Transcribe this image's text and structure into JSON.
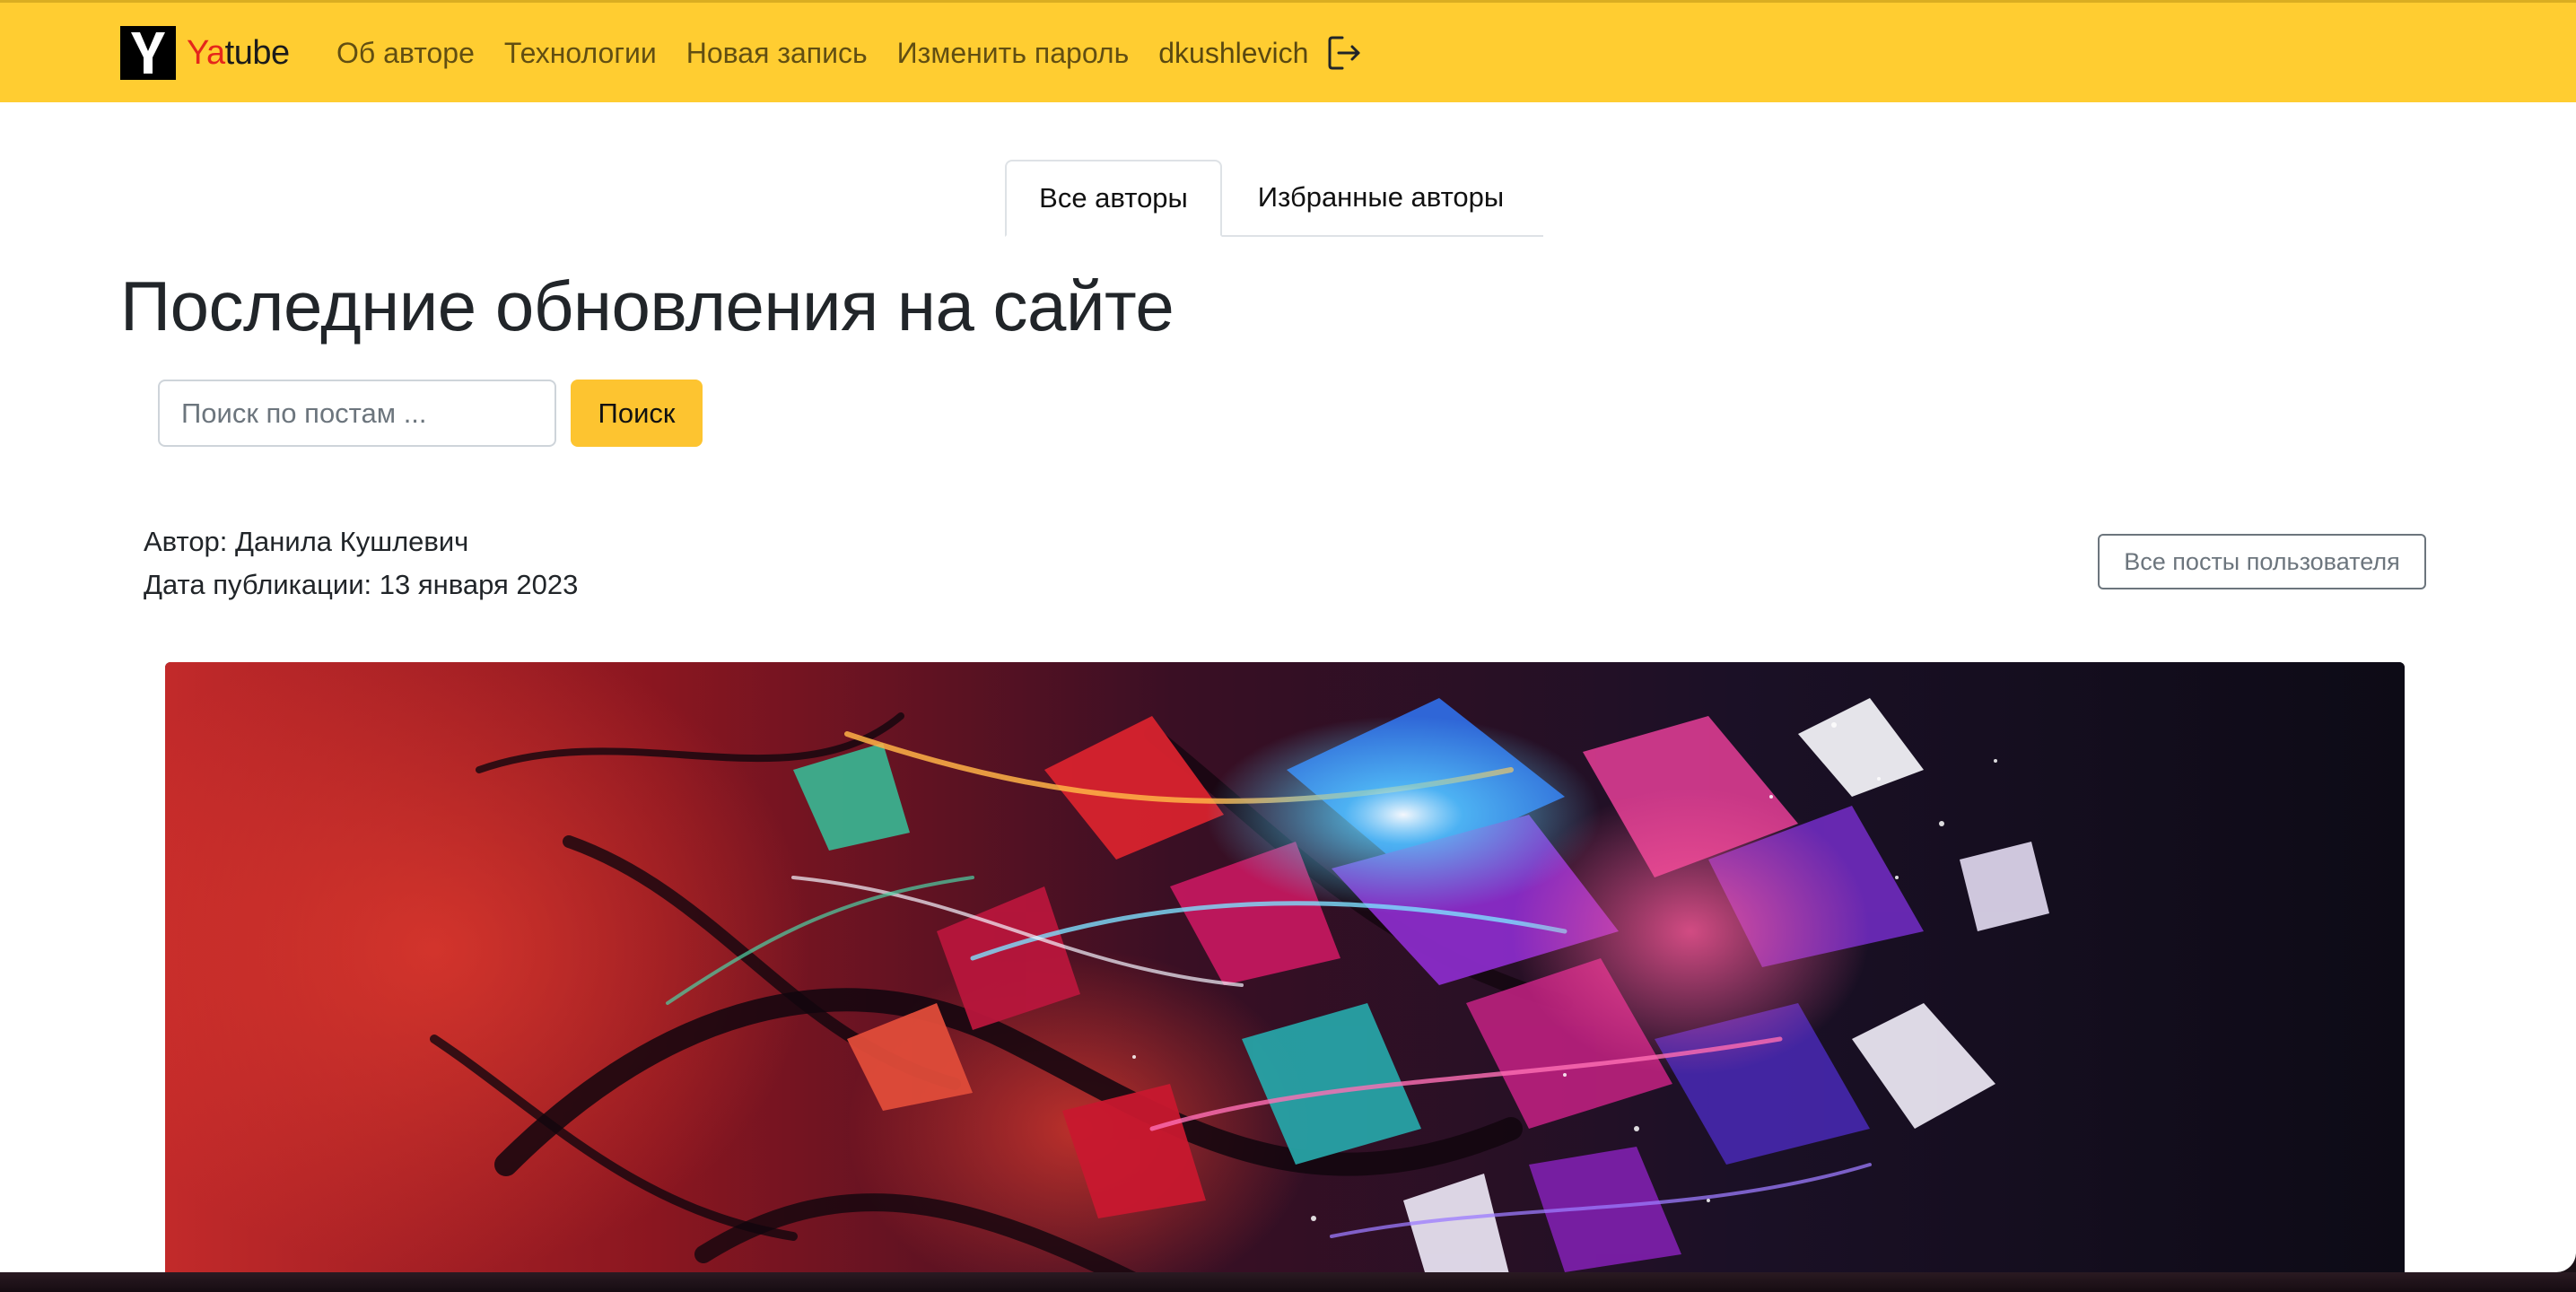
{
  "brand": {
    "logo_letter": "Y",
    "name_prefix": "Ya",
    "name_suffix": "tube"
  },
  "nav": {
    "links": [
      "Об авторе",
      "Технологии",
      "Новая запись",
      "Изменить пароль"
    ],
    "username": "dkushlevich",
    "logout_icon": "logout-icon"
  },
  "tabs": {
    "all_authors": "Все авторы",
    "favorite_authors": "Избранные авторы"
  },
  "page": {
    "title": "Последние обновления на сайте"
  },
  "search": {
    "placeholder": "Поиск по постам ...",
    "button_label": "Поиск"
  },
  "post": {
    "author_line": "Автор: Данила Кушлевич",
    "date_line": "Дата публикации: 13 января 2023",
    "all_posts_label": "Все посты пользователя",
    "image_name": "abstract-art-image"
  },
  "colors": {
    "navbar": "#ffcd31",
    "accent_button": "#fdc430",
    "brand_red": "#e5271b"
  }
}
